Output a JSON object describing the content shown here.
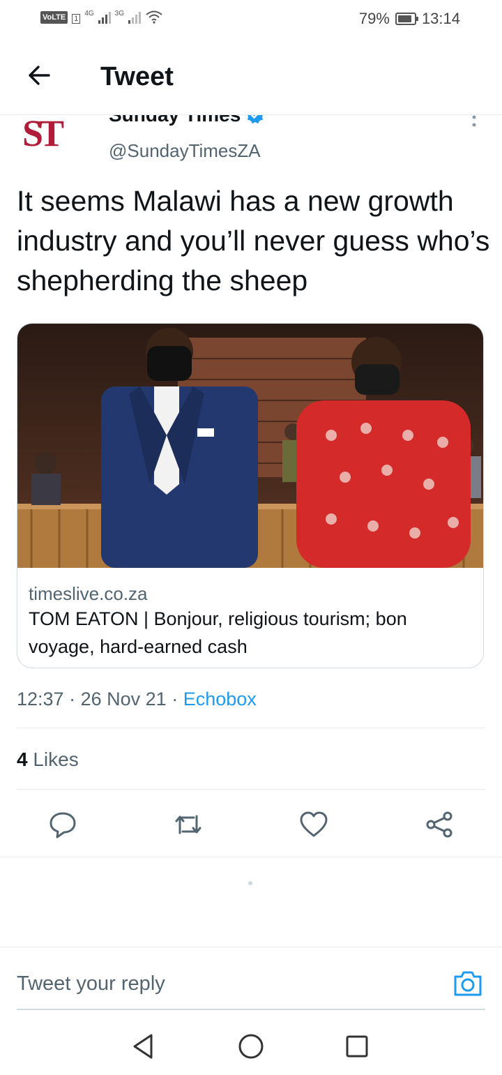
{
  "status_bar": {
    "volte": "VoLTE",
    "sim": "1",
    "net1": "4G",
    "net2": "3G",
    "battery": "79%",
    "time": "13:14"
  },
  "header": {
    "title": "Tweet"
  },
  "author": {
    "logo_text": "ST",
    "name": "Sunday Times",
    "handle": "@SundayTimesZA",
    "verified": true
  },
  "tweet": {
    "text": "It seems Malawi has a new growth industry and you’ll never guess who’s shepherding the sheep",
    "time": "12:37",
    "date": "26 Nov 21",
    "source": "Echobox",
    "likes_count": "4",
    "likes_label": "Likes"
  },
  "card": {
    "domain": "timeslive.co.za",
    "title": "TOM EATON | Bonjour, religious tourism; bon voyage, hard-earned cash"
  },
  "reply": {
    "placeholder": "Tweet your reply"
  },
  "colors": {
    "accent": "#1d9bf0",
    "text": "#0f1419",
    "muted": "#536471",
    "logo": "#b01c3a"
  }
}
